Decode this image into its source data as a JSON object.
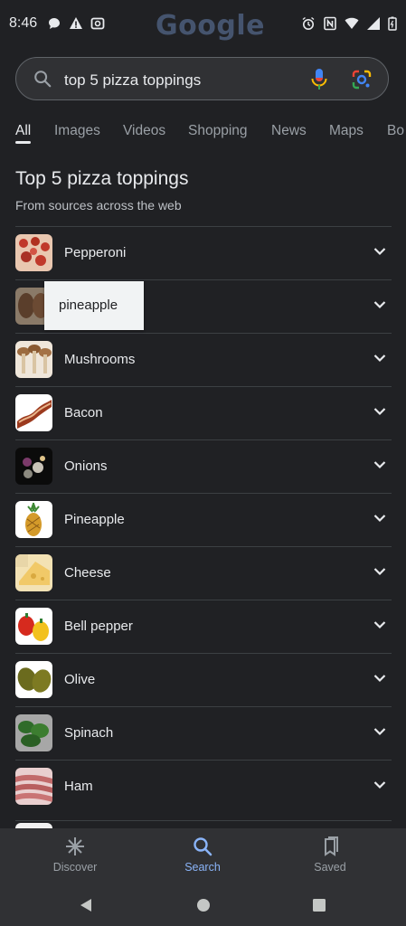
{
  "status_bar": {
    "time": "8:46",
    "left_icons": [
      "chat-bubble-icon",
      "warning-icon",
      "cast-icon"
    ],
    "right_icons": [
      "alarm-icon",
      "nfc-icon",
      "wifi-icon",
      "signal-icon",
      "battery-icon"
    ]
  },
  "logo": "Google",
  "search": {
    "query": "top 5 pizza toppings"
  },
  "tabs": [
    {
      "label": "All"
    },
    {
      "label": "Images"
    },
    {
      "label": "Videos"
    },
    {
      "label": "Shopping"
    },
    {
      "label": "News"
    },
    {
      "label": "Maps"
    },
    {
      "label": "Bo"
    }
  ],
  "results": {
    "title": "Top 5 pizza toppings",
    "subtitle": "From sources across the web",
    "items": [
      {
        "label": "Pepperoni"
      },
      {
        "label": ""
      },
      {
        "label": "Mushrooms"
      },
      {
        "label": "Bacon"
      },
      {
        "label": "Onions"
      },
      {
        "label": "Pineapple"
      },
      {
        "label": "Cheese"
      },
      {
        "label": "Bell pepper"
      },
      {
        "label": "Olive"
      },
      {
        "label": "Spinach"
      },
      {
        "label": "Ham"
      }
    ]
  },
  "tooltip": {
    "text": "pineapple"
  },
  "bottom_nav": {
    "items": [
      {
        "label": "Discover"
      },
      {
        "label": "Search"
      },
      {
        "label": "Saved"
      }
    ]
  },
  "colors": {
    "background": "#202124",
    "accent": "#8ab4f8",
    "search_box": "#303134"
  }
}
